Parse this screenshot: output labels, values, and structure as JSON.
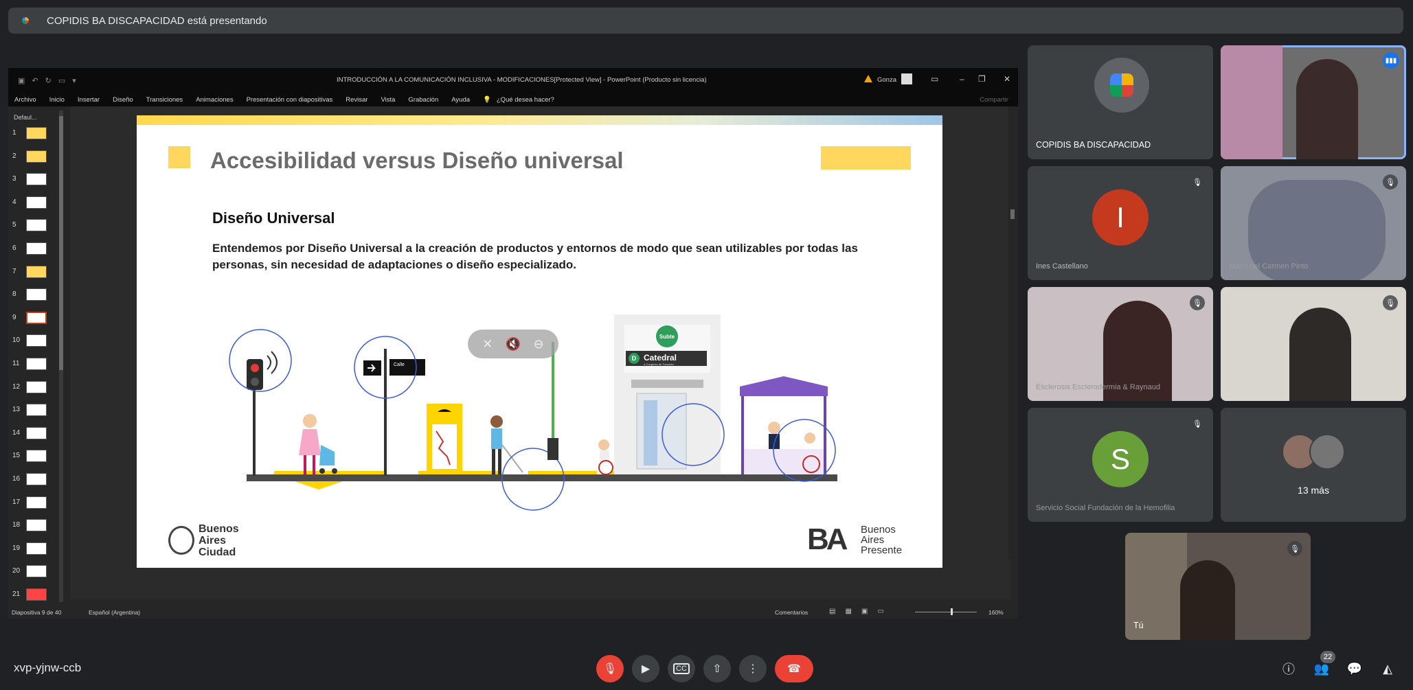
{
  "banner": {
    "text": "COPIDIS BA DISCAPACIDAD está presentando"
  },
  "ppt": {
    "title": "INTRODUCCIÓN A LA COMUNICACIÓN INCLUSIVA - MODIFICACIONES[Protected View] - PowerPoint (Producto sin licencia)",
    "user": "Gonza",
    "menu": [
      "Archivo",
      "Inicio",
      "Insertar",
      "Diseño",
      "Transiciones",
      "Animaciones",
      "Presentación con diapositivas",
      "Revisar",
      "Vista",
      "Grabación",
      "Ayuda",
      "¿Qué desea hacer?"
    ],
    "share": "Compartir",
    "section": "Defaul...",
    "thumbs": [
      "1",
      "2",
      "3",
      "4",
      "5",
      "6",
      "7",
      "8",
      "9",
      "10",
      "11",
      "12",
      "13",
      "14",
      "15",
      "16",
      "17",
      "18",
      "19",
      "20",
      "21"
    ],
    "selected_slide": "9",
    "status": {
      "slide": "Diapositiva 9 de 40",
      "lang": "Español (Argentina)",
      "comments": "Comentarios",
      "zoom": "160%"
    }
  },
  "slide": {
    "title": "Accesibilidad versus Diseño universal",
    "subhead": "Diseño Universal",
    "body": "Entendemos por Diseño Universal a la creación de productos y entornos de modo que sean utilizables por todas las personas, sin necesidad de adaptaciones o diseño especializado.",
    "street_sign": "Calle",
    "subte_badge": "Subte",
    "station_letter": "D",
    "station": "Catedral",
    "station_sub": "a Congreso de Tucumán",
    "logo_left": [
      "Buenos",
      "Aires",
      "Ciudad"
    ],
    "logo_right_mark": "BA",
    "logo_right": [
      "Buenos",
      "Aires",
      "Presente"
    ]
  },
  "tiles": [
    {
      "name": "COPIDIS BA DISCAPACIDAD",
      "muted": false
    },
    {
      "name": "",
      "muted": false,
      "speaking": true
    },
    {
      "name": "Ines Castellano",
      "initial": "I",
      "color": "#c5391e",
      "muted": true
    },
    {
      "name": "Maria del Carmen Pinto",
      "muted": true
    },
    {
      "name": "Esclerosis Esclerodermia & Raynaud",
      "muted": true
    },
    {
      "name": "",
      "muted": true
    },
    {
      "name": "Servicio Social Fundación de la Hemofilia",
      "initial": "S",
      "color": "#689f38",
      "muted": true
    },
    {
      "more": "13 más"
    },
    {
      "name": "Tú",
      "muted": true
    }
  ],
  "bottom": {
    "meeting_code": "xvp-yjnw-ccb",
    "participants_count": "22"
  },
  "icons": {
    "mic_off": "mic-off-icon",
    "camera": "camera-icon",
    "captions": "captions-icon",
    "present": "present-icon",
    "more": "more-icon",
    "hangup": "hangup-icon",
    "info": "info-icon",
    "people": "people-icon",
    "chat": "chat-icon",
    "activities": "activities-icon"
  },
  "colors": {
    "end_call": "#ea4335",
    "accent_yellow": "#ffd75e",
    "active_outline": "#8ab4f8"
  }
}
